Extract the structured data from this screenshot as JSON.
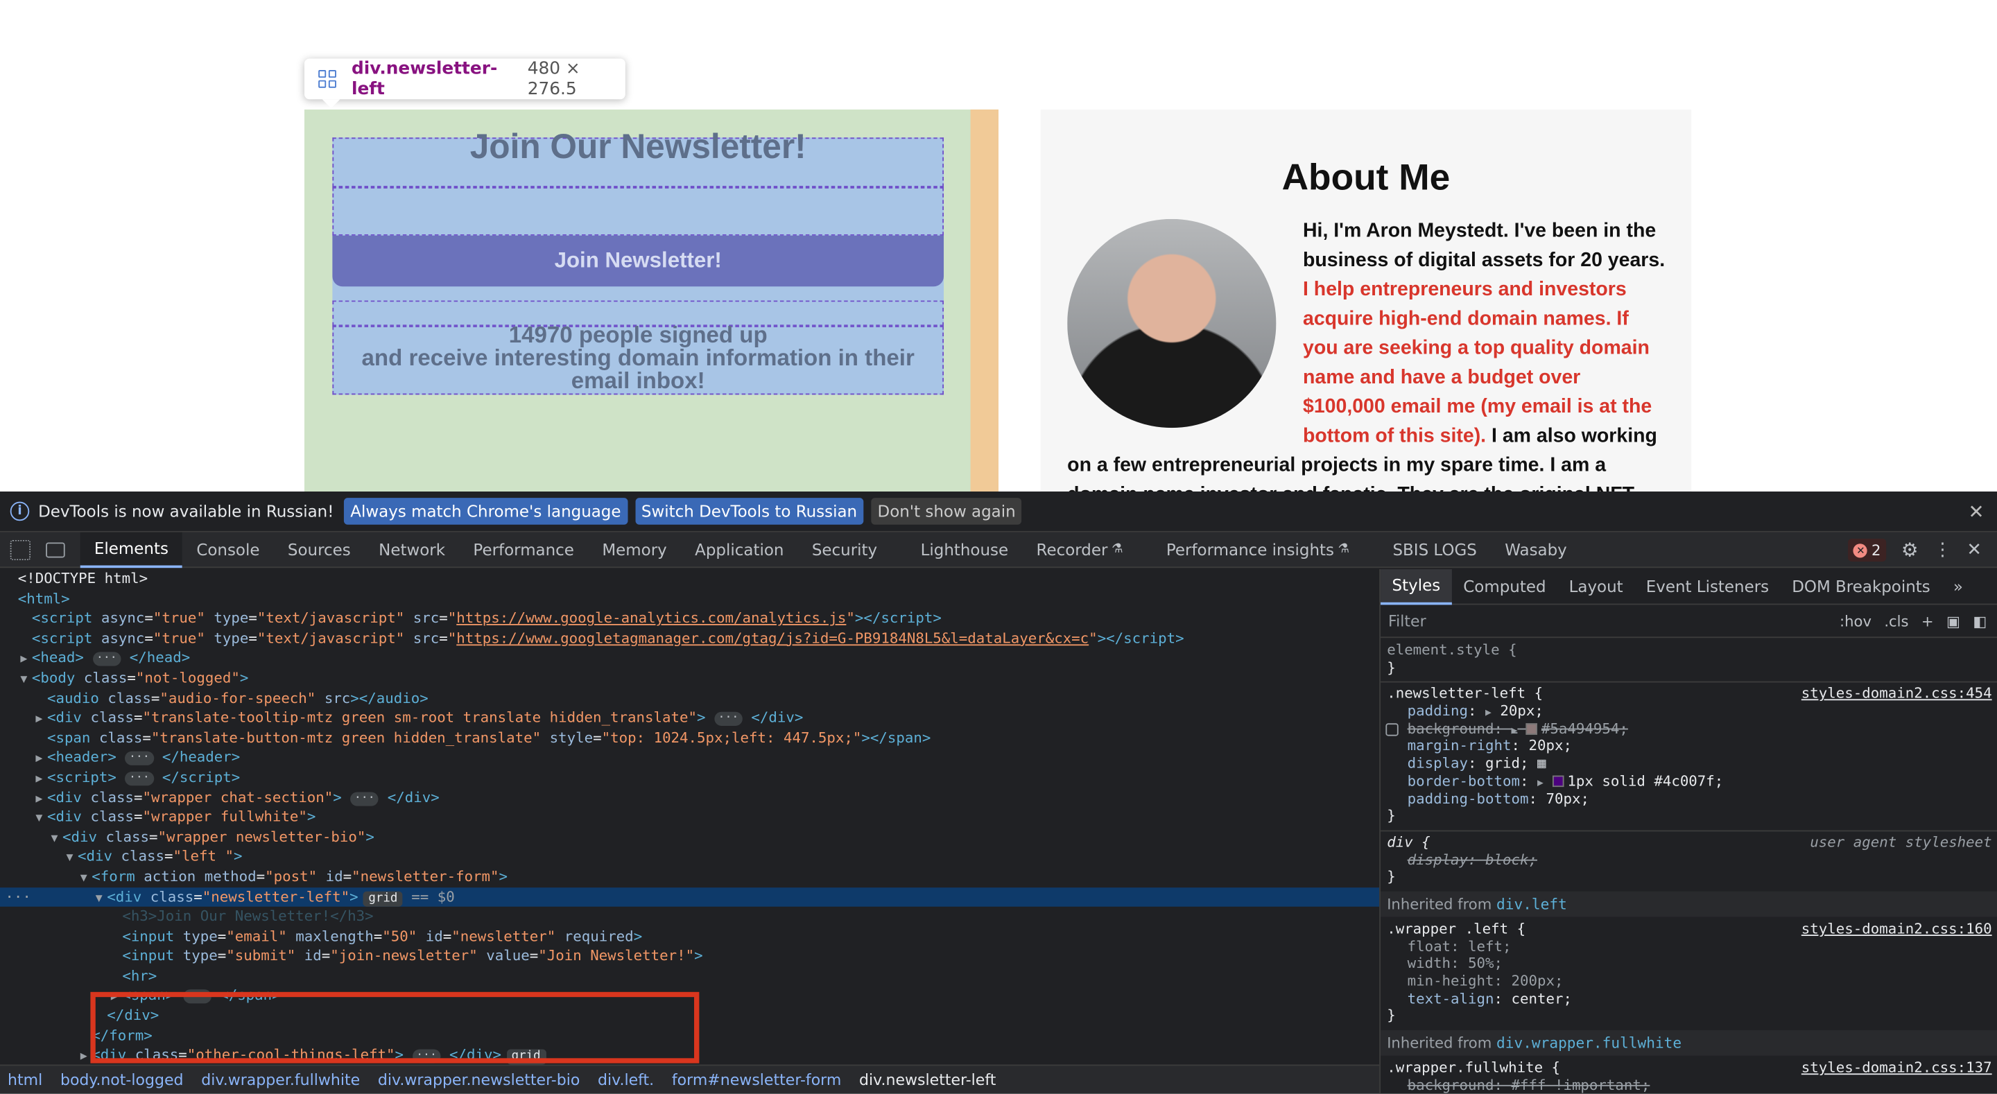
{
  "page": {
    "tooltip": {
      "selector": "div.newsletter-left",
      "dimensions": "480 × 276.5"
    },
    "newsletter": {
      "title": "Join Our Newsletter!",
      "button_label": "Join Newsletter!",
      "signed_up": "14970 people signed up",
      "note_line2": "and receive interesting domain information in their",
      "note_line3": "email inbox!"
    },
    "about": {
      "heading": "About Me",
      "intro": "Hi, I'm Aron Meystedt. I've been in the business of digital assets for 20 years.",
      "highlight": "I help entrepreneurs and investors acquire high-end domain names. If you are seeking a top quality domain name and have a budget over $100,000 email me (my email is at the bottom of this site).",
      "rest": "I am also working on a few entrepreneurial projects in my spare time. I am a domain name investor and fanatic. They are the original NFT - except with a"
    }
  },
  "devtools": {
    "infobar": {
      "message": "DevTools is now available in Russian!",
      "btn_match": "Always match Chrome's language",
      "btn_switch": "Switch DevTools to Russian",
      "btn_dismiss": "Don't show again"
    },
    "tabs": [
      "Elements",
      "Console",
      "Sources",
      "Network",
      "Performance",
      "Memory",
      "Application",
      "Security",
      "Lighthouse",
      "Recorder",
      "Performance insights",
      "SBIS LOGS",
      "Wasaby"
    ],
    "error_count": "2",
    "styles_tabs": [
      "Styles",
      "Computed",
      "Layout",
      "Event Listeners",
      "DOM Breakpoints"
    ],
    "filter_placeholder": "Filter",
    "filter_hov": ":hov",
    "filter_cls": ".cls",
    "dom": {
      "doctype": "<!DOCTYPE html>",
      "html": "<html>",
      "script1_src": "https://www.google-analytics.com/analytics.js",
      "script2_src": "https://www.googletagmanager.com/gtag/js?id=G-PB9184N8L5&l=dataLayer&cx=c",
      "body_class": "not-logged",
      "span_style": "top: 1024.5px;left: 447.5px;",
      "input_maxlength": "50",
      "input_id": "newsletter",
      "submit_id": "join-newsletter",
      "submit_value": "Join Newsletter!",
      "selected_suffix": "== $0"
    },
    "styles": {
      "element_style": "element.style {",
      "rule1_selector": ".newsletter-left {",
      "rule1_source": "styles-domain2.css:454",
      "rule1_props": [
        {
          "name": "padding",
          "value": "20px;"
        },
        {
          "name": "background",
          "value": "#5a494954;"
        },
        {
          "name": "margin-right",
          "value": "20px;"
        },
        {
          "name": "display",
          "value": "grid;"
        },
        {
          "name": "border-bottom",
          "value": "1px solid #4c007f;"
        },
        {
          "name": "padding-bottom",
          "value": "70px;"
        }
      ],
      "ua_selector": "div {",
      "ua_label": "user agent stylesheet",
      "ua_prop": "display: block;",
      "inherit1": "div.left",
      "rule2_selector": ".wrapper .left {",
      "rule2_source": "styles-domain2.css:160",
      "rule2_props": [
        {
          "name": "float",
          "value": "left;"
        },
        {
          "name": "width",
          "value": "50%;"
        },
        {
          "name": "min-height",
          "value": "200px;"
        },
        {
          "name": "text-align",
          "value": "center;"
        }
      ],
      "inherit2": "div.wrapper.fullwhite",
      "rule3_selector": ".wrapper.fullwhite {",
      "rule3_source": "styles-domain2.css:137",
      "rule3_prop": "background: #fff !important;"
    },
    "breadcrumbs": [
      "html",
      "body.not-logged",
      "div.wrapper.fullwhite",
      "div.wrapper.newsletter-bio",
      "div.left.",
      "form#newsletter-form",
      "div.newsletter-left"
    ],
    "colors": {
      "accent": "#8ab4f8",
      "highlight_red": "#d9361e",
      "purple_swatch": "#4c007f"
    }
  }
}
